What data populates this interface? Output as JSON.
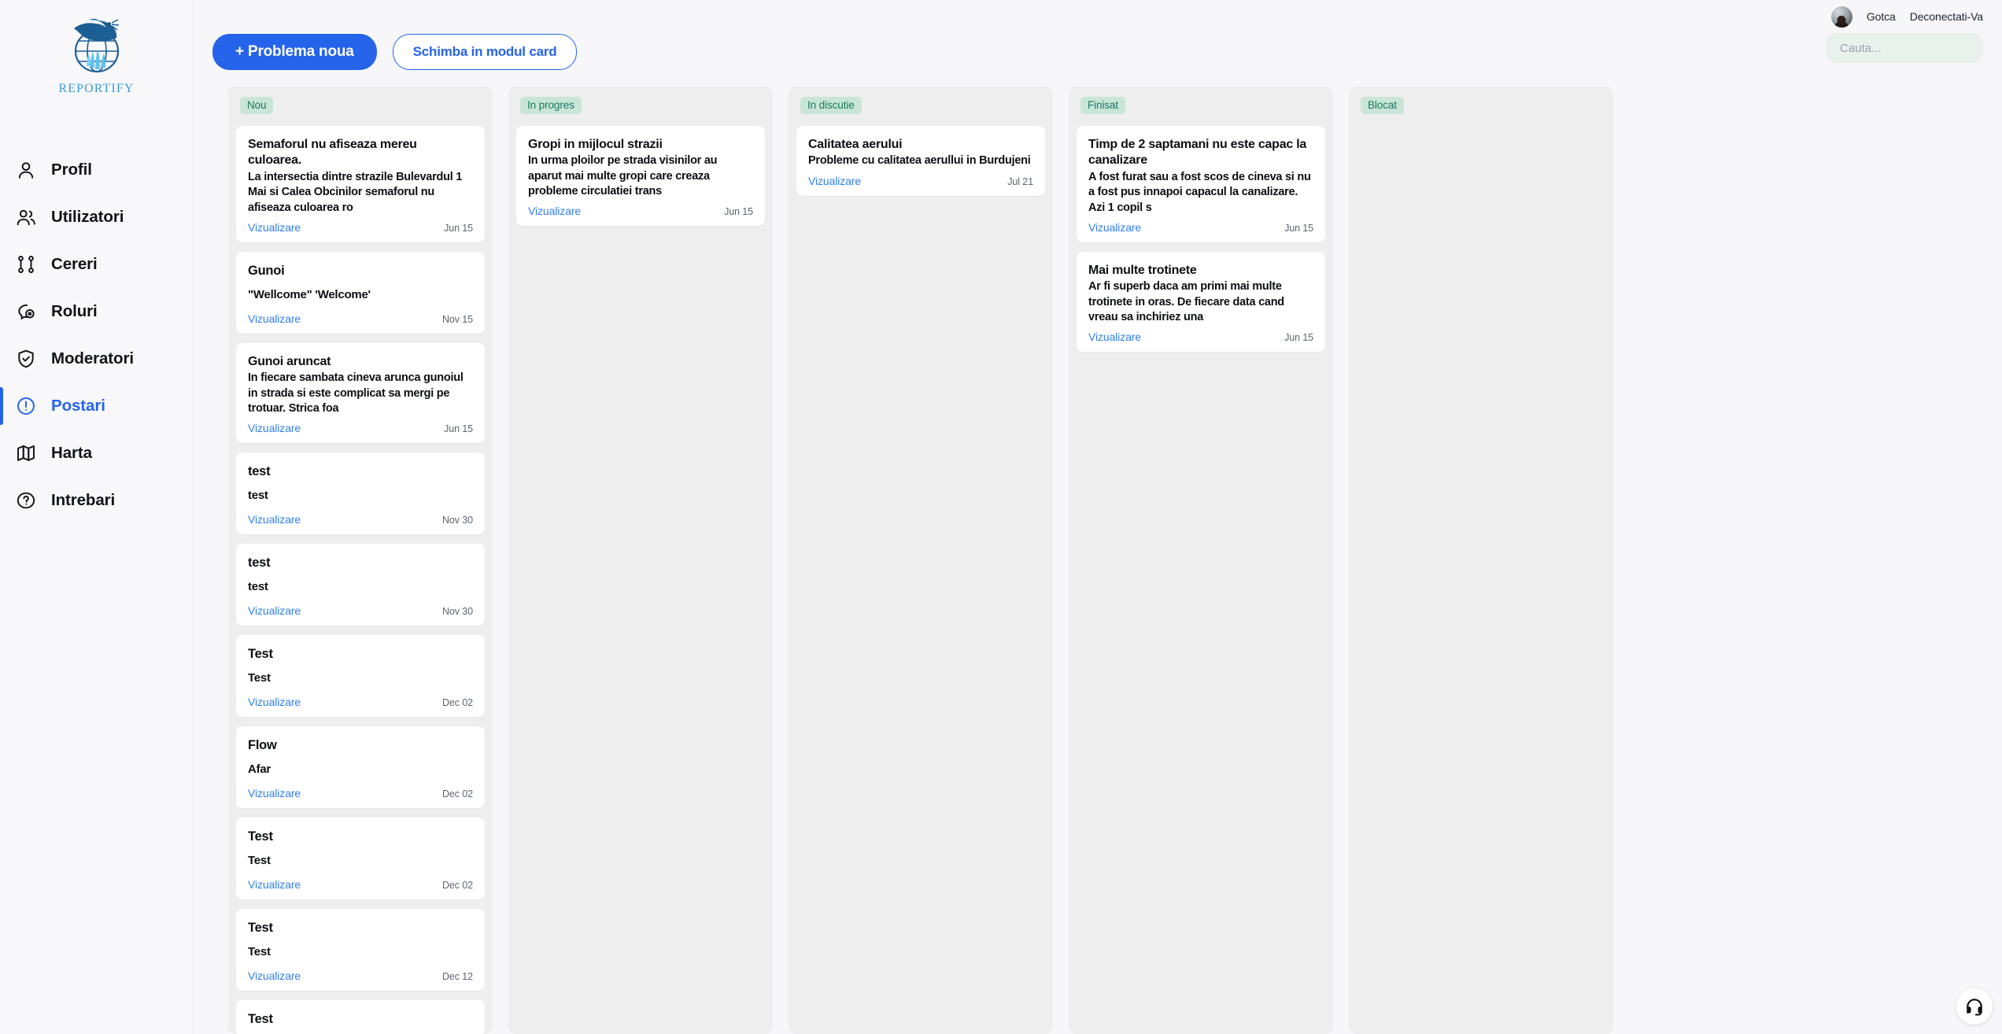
{
  "brand": {
    "name": "Reportify",
    "accent": "#3c9cd4"
  },
  "sidebar": {
    "items": [
      {
        "label": "Profil",
        "icon": "user-icon",
        "active": false
      },
      {
        "label": "Utilizatori",
        "icon": "users-icon",
        "active": false
      },
      {
        "label": "Cereri",
        "icon": "git-pull-icon",
        "active": false
      },
      {
        "label": "Roluri",
        "icon": "roles-icon",
        "active": false
      },
      {
        "label": "Moderatori",
        "icon": "shield-check-icon",
        "active": false
      },
      {
        "label": "Postari",
        "icon": "alert-circle-icon",
        "active": true
      },
      {
        "label": "Harta",
        "icon": "map-icon",
        "active": false
      },
      {
        "label": "Intrebari",
        "icon": "question-circle-icon",
        "active": false
      }
    ],
    "active_color": "#2563eb"
  },
  "toolbar": {
    "new_issue_label": "+ Problema noua",
    "toggle_view_label": "Schimba in modul card",
    "primary_color": "#2563eb"
  },
  "account": {
    "username": "Gotca",
    "logout_label": "Deconectati-Va",
    "avatar": "avatar"
  },
  "search": {
    "placeholder": "Cauta...",
    "value": ""
  },
  "support": {
    "icon": "headset-icon"
  },
  "board": {
    "link_label": "Vizualizare",
    "columns": [
      {
        "status": "Nou",
        "cards": [
          {
            "title": "Semaforul nu afiseaza mereu culoarea.",
            "desc": "La intersectia dintre strazile Bulevardul 1 Mai si Calea Obcinilor semaforul nu afiseaza culoarea ro",
            "link": "Vizualizare",
            "date": "Jun 15",
            "spaced": false
          },
          {
            "title": "Gunoi",
            "desc": "\"Wellcome\" 'Welcome'",
            "link": "Vizualizare",
            "date": "Nov 15",
            "spaced": true
          },
          {
            "title": "Gunoi aruncat",
            "desc": "In fiecare sambata cineva arunca gunoiul in strada si este complicat sa mergi pe trotuar. Strica foa",
            "link": "Vizualizare",
            "date": "Jun 15",
            "spaced": false
          },
          {
            "title": "test",
            "desc": "test",
            "link": "Vizualizare",
            "date": "Nov 30",
            "spaced": true
          },
          {
            "title": "test",
            "desc": "test",
            "link": "Vizualizare",
            "date": "Nov 30",
            "spaced": true
          },
          {
            "title": "Test",
            "desc": "Test",
            "link": "Vizualizare",
            "date": "Dec 02",
            "spaced": true
          },
          {
            "title": "Flow",
            "desc": "Afar",
            "link": "Vizualizare",
            "date": "Dec 02",
            "spaced": true
          },
          {
            "title": "Test",
            "desc": "Test",
            "link": "Vizualizare",
            "date": "Dec 02",
            "spaced": true
          },
          {
            "title": "Test",
            "desc": "Test",
            "link": "Vizualizare",
            "date": "Dec 12",
            "spaced": true
          },
          {
            "title": "Test",
            "desc": "",
            "link": "",
            "date": "",
            "spaced": true
          }
        ]
      },
      {
        "status": "In progres",
        "cards": [
          {
            "title": "Gropi in mijlocul strazii",
            "desc": "In urma ploilor pe strada visinilor au aparut mai multe gropi care creaza probleme circulatiei trans",
            "link": "Vizualizare",
            "date": "Jun 15",
            "spaced": false
          }
        ]
      },
      {
        "status": "In discutie",
        "cards": [
          {
            "title": "Calitatea aerului",
            "desc": "Probleme cu calitatea aerullui in Burdujeni",
            "link": "Vizualizare",
            "date": "Jul 21",
            "spaced": false
          }
        ]
      },
      {
        "status": "Finisat",
        "cards": [
          {
            "title": "Timp de 2 saptamani nu este capac la canalizare",
            "desc": "A fost furat sau a fost scos de cineva si nu a fost pus innapoi capacul la canalizare. Azi 1 copil s",
            "link": "Vizualizare",
            "date": "Jun 15",
            "spaced": false
          },
          {
            "title": "Mai multe trotinete",
            "desc": "Ar fi superb daca am primi mai multe trotinete in oras. De fiecare data cand vreau sa inchiriez una",
            "link": "Vizualizare",
            "date": "Jun 15",
            "spaced": false
          }
        ]
      },
      {
        "status": "Blocat",
        "cards": []
      }
    ]
  }
}
